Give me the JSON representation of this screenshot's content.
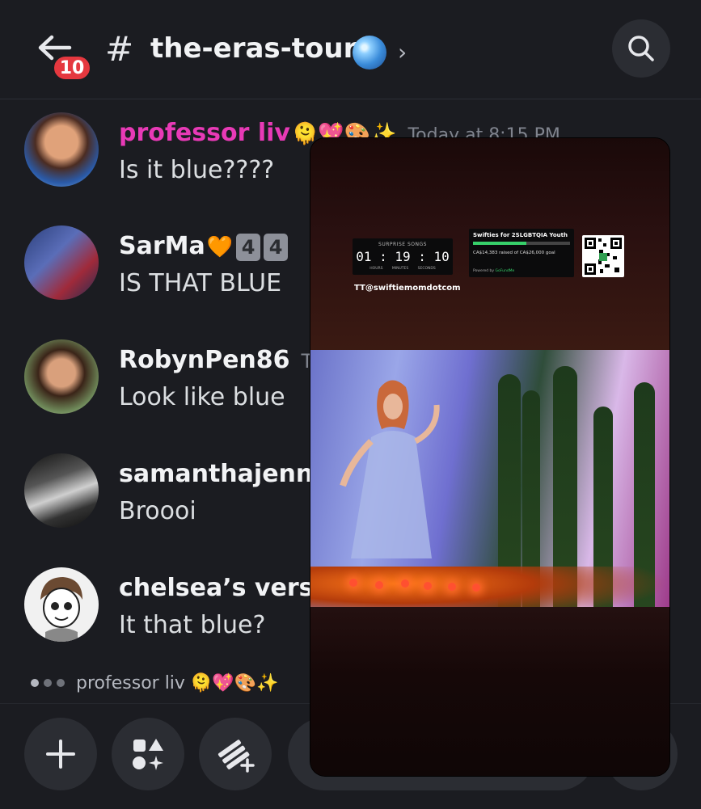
{
  "header": {
    "unread_count": "10",
    "channel_hash": "#",
    "channel_name": "the-eras-tour",
    "channel_emoji": "disco-ball-icon",
    "chevron": "›",
    "search_icon": "search-icon"
  },
  "messages": [
    {
      "author": "professor liv",
      "author_color": "#e83ab6",
      "emojis": "🫠💖🎨✨",
      "time": "Today at 8:15 PM",
      "text": "Is it blue????"
    },
    {
      "author": "SarMa",
      "author_color": "#f2f3f5",
      "emojis": "🧡",
      "keycaps": [
        "4",
        "4"
      ],
      "text": "IS THAT BLUE"
    },
    {
      "author": "RobynPen86",
      "author_color": "#f2f3f5",
      "time": "To",
      "text": "Look like blue"
    },
    {
      "author": "samanthajennif",
      "author_color": "#f2f3f5",
      "text": "Broooi"
    },
    {
      "author": "chelsea’s versio",
      "author_color": "#f2f3f5",
      "text": "It that blue?"
    }
  ],
  "typing": {
    "user": "professor liv",
    "emojis": "🫠💖🎨✨"
  },
  "composer": {
    "plus_icon": "plus-icon",
    "apps_icon": "apps-icon",
    "stickers_icon": "gift-add-icon"
  },
  "video": {
    "timer_caption": "SURPRISE SONGS",
    "timer_value": "01 : 19 : 10",
    "timer_units": "HOURS MINUTES SECONDS",
    "fund_title": "Swifties for 2SLGBTQIA Youth",
    "fund_raised": "CA$14,383 raised of CA$26,000 goal",
    "fund_progress": 0.55,
    "fund_powered": "Powered by",
    "fund_powered_brand": "GoFundMe",
    "handle": "TT@swiftiemomdotcom"
  }
}
